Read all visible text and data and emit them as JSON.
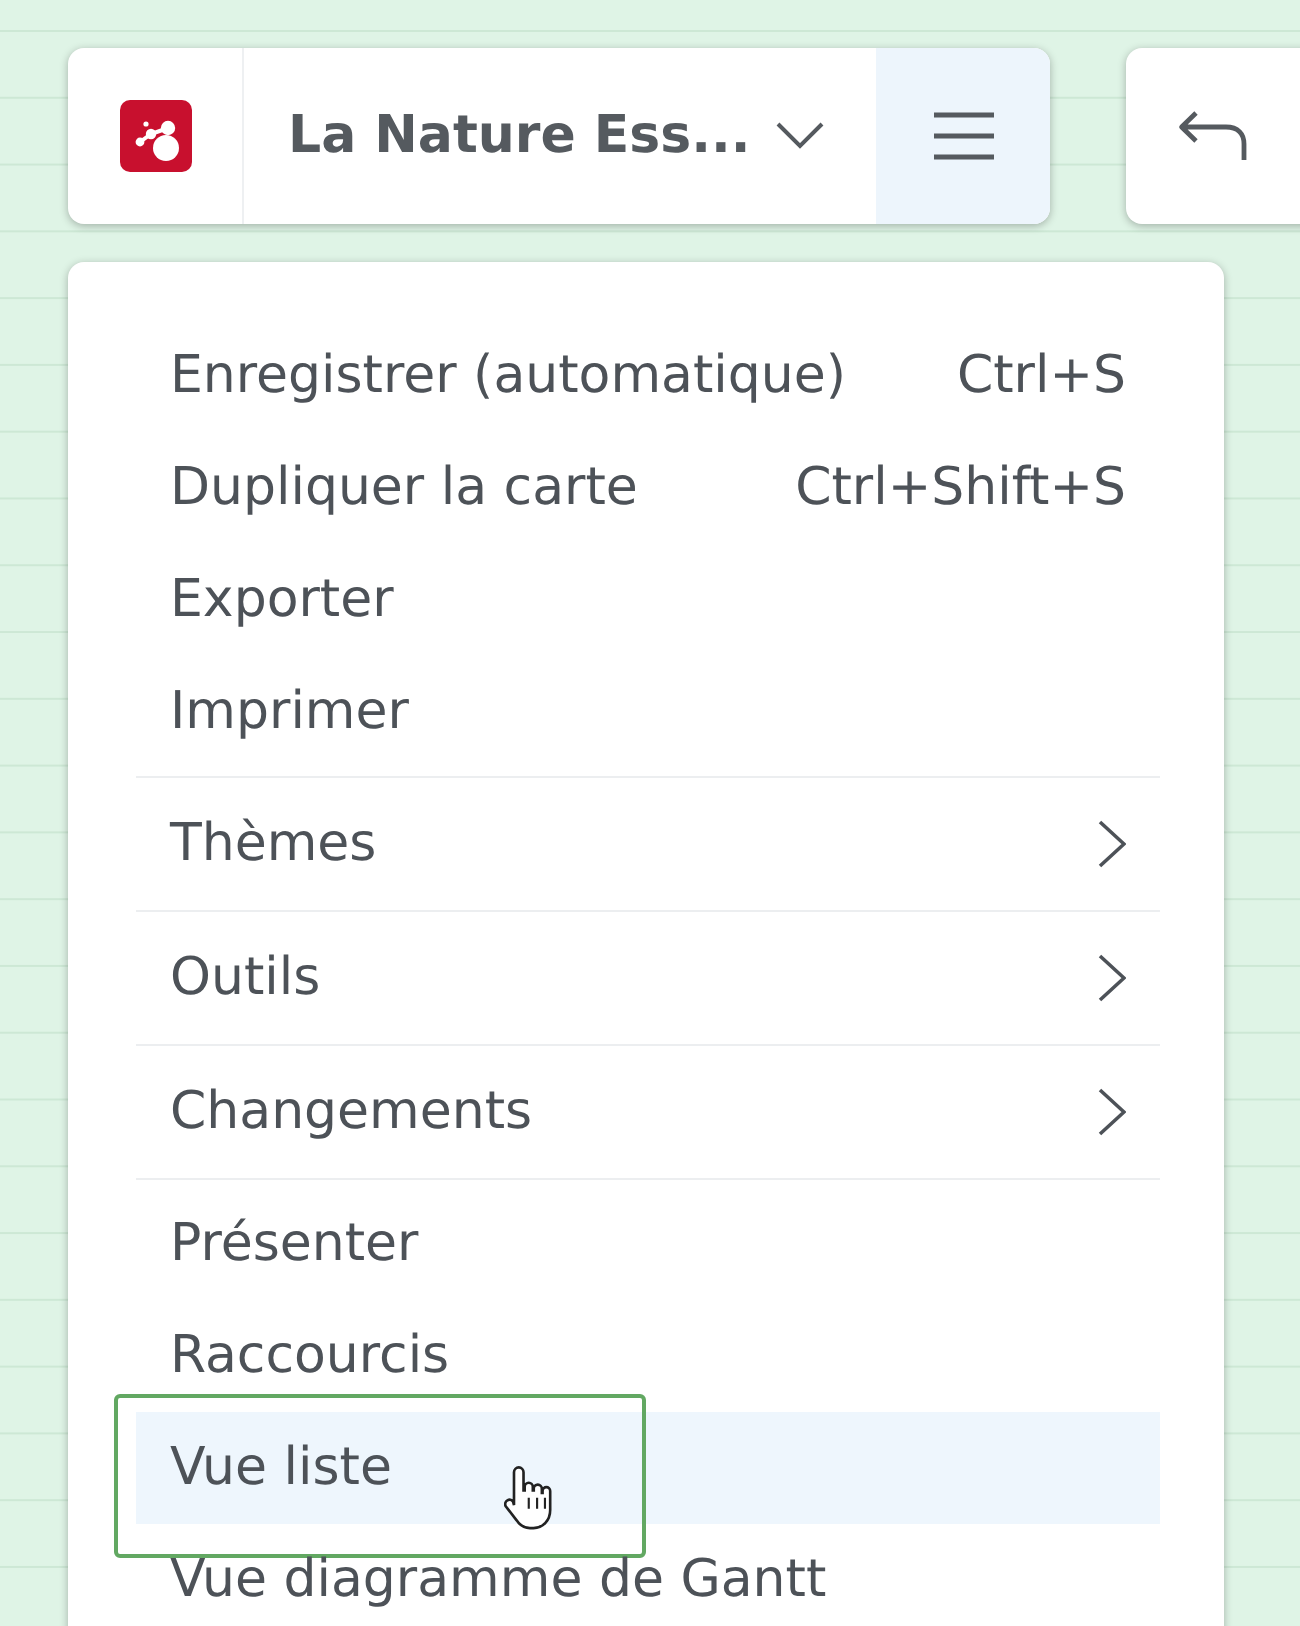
{
  "toolbar": {
    "title": "La Nature Ess...",
    "menu_open": true
  },
  "menu": {
    "sections": [
      {
        "items": [
          {
            "kind": "action",
            "label": "Enregistrer (automatique)",
            "shortcut": "Ctrl+S",
            "selected": false,
            "framed": false
          },
          {
            "kind": "action",
            "label": "Dupliquer la carte",
            "shortcut": "Ctrl+Shift+S",
            "selected": false,
            "framed": false
          },
          {
            "kind": "action",
            "label": "Exporter",
            "selected": false,
            "framed": false
          },
          {
            "kind": "action",
            "label": "Imprimer",
            "selected": false,
            "framed": false
          }
        ]
      },
      {
        "items": [
          {
            "kind": "submenu",
            "label": "Thèmes",
            "selected": false,
            "framed": false
          }
        ]
      },
      {
        "items": [
          {
            "kind": "submenu",
            "label": "Outils",
            "selected": false,
            "framed": false
          }
        ]
      },
      {
        "items": [
          {
            "kind": "submenu",
            "label": "Changements",
            "selected": false,
            "framed": false
          }
        ]
      },
      {
        "items": [
          {
            "kind": "action",
            "label": "Présenter",
            "selected": false,
            "framed": false
          },
          {
            "kind": "action",
            "label": "Raccourcis",
            "selected": false,
            "framed": false
          },
          {
            "kind": "action",
            "label": "Vue liste",
            "selected": true,
            "framed": true
          },
          {
            "kind": "action",
            "label": "Vue diagramme de Gantt",
            "selected": false,
            "framed": false
          }
        ]
      }
    ]
  }
}
